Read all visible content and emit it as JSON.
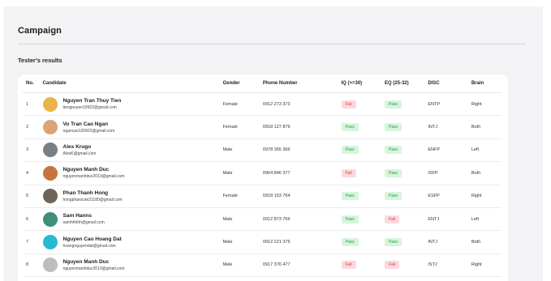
{
  "header": {
    "title": "Campaign",
    "section_title": "Tester's results"
  },
  "table": {
    "columns": [
      "No.",
      "Candidate",
      "Gender",
      "Phone Number",
      "IQ (>=30)",
      "EQ (25-32)",
      "DISC",
      "Brain"
    ],
    "rows": [
      {
        "no": "1",
        "name": "Nguyen Tran Thuy Tien",
        "email": "tiengnuyen10922@gmail.com",
        "gender": "Female",
        "phone": "0912 273 373",
        "iq": "Fail",
        "eq": "Pass",
        "disc": "ENTP",
        "brain": "Right",
        "avatar_color": "#e9b44a"
      },
      {
        "no": "2",
        "name": "Vo Tran Cao Ngan",
        "email": "ngancao120922@gmail.com",
        "gender": "Female",
        "phone": "0918 127 879",
        "iq": "Pass",
        "eq": "Pass",
        "disc": "INTJ",
        "brain": "Both",
        "avatar_color": "#d9a577"
      },
      {
        "no": "3",
        "name": "Alex Krugo",
        "email": "AlexK@gmail.com",
        "gender": "Male",
        "phone": "0978 365 366",
        "iq": "Pass",
        "eq": "Pass",
        "disc": "ENFP",
        "brain": "Left",
        "avatar_color": "#7a7f86"
      },
      {
        "no": "4",
        "name": "Nguyen Manh Duc",
        "email": "nguyenmanhduc2013@gmail.com",
        "gender": "Male",
        "phone": "0964 846 377",
        "iq": "Fail",
        "eq": "Pass",
        "disc": "ISFP",
        "brain": "Both",
        "avatar_color": "#c6763d"
      },
      {
        "no": "5",
        "name": "Phan Thanh Hong",
        "email": "hongphancute21180@gmail.com",
        "gender": "Female",
        "phone": "0918 153 764",
        "iq": "Pass",
        "eq": "Pass",
        "disc": "ESFP",
        "brain": "Right",
        "avatar_color": "#6e6458"
      },
      {
        "no": "6",
        "name": "Sam Hanns",
        "email": "samhhhhh@gmail.com",
        "gender": "Male",
        "phone": "0912 873 766",
        "iq": "Pass",
        "eq": "Fail",
        "disc": "ENTJ",
        "brain": "Left",
        "avatar_color": "#3f8f7a"
      },
      {
        "no": "7",
        "name": "Nguyen Cao Hoang Dat",
        "email": "hoangnguyendat@gmail.com",
        "gender": "Male",
        "phone": "0912 221 376",
        "iq": "Pass",
        "eq": "Pass",
        "disc": "INTJ",
        "brain": "Both",
        "avatar_color": "#2ab8d6"
      },
      {
        "no": "8",
        "name": "Nguyen Manh Duc",
        "email": "nguyenmanhduc2013@gmail.com",
        "gender": "Male",
        "phone": "0917 376 477",
        "iq": "Fail",
        "eq": "Fail",
        "disc": "ISTJ",
        "brain": "Right",
        "avatar_color": "#bdbdbd"
      }
    ]
  },
  "colors": {
    "pass_bg": "#d6f5dc",
    "pass_text": "#2a9a43",
    "fail_bg": "#fbd9dc",
    "fail_text": "#d63b48",
    "panel_bg": "#f3f3f5"
  }
}
